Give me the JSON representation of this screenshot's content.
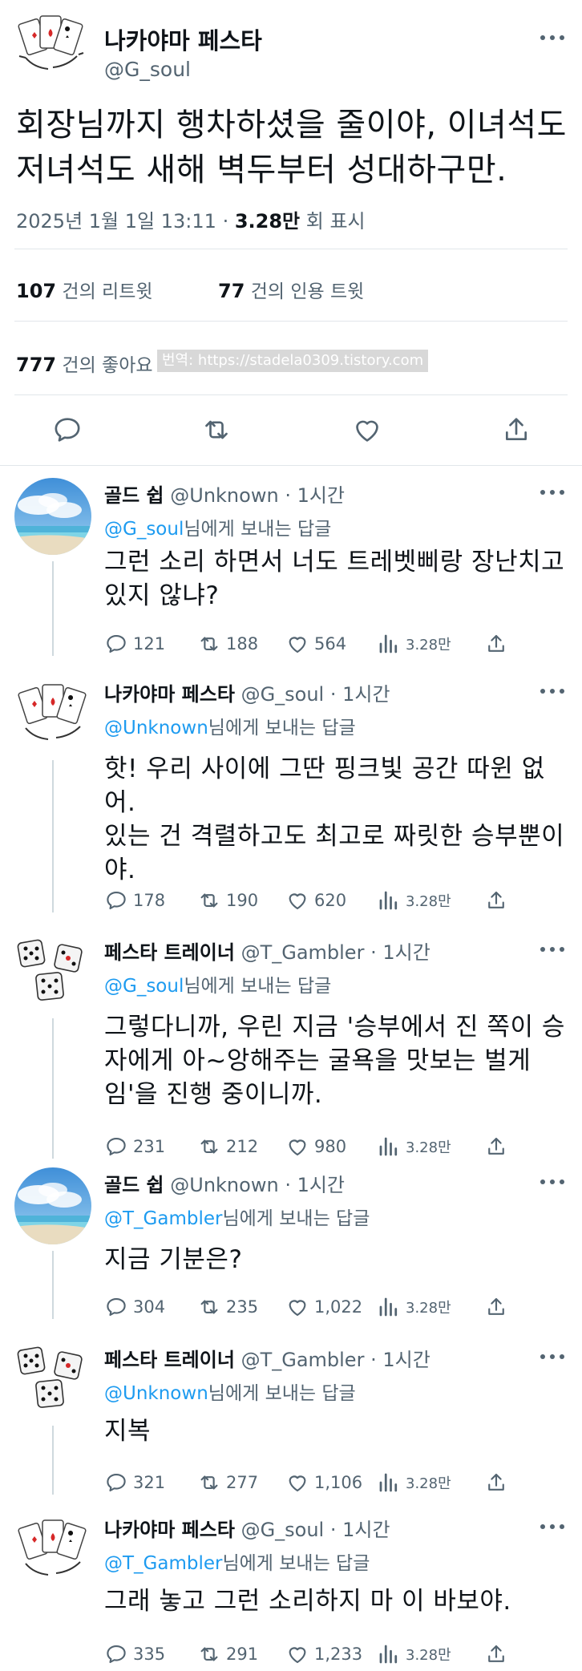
{
  "main": {
    "name": "나카야마 페스타",
    "handle": "@G_soul",
    "text": "회장님까지 행차하셨을 줄이야, 이녀석도 저녀석도 새해 벽두부터 성대하구만.",
    "date": "2025년 1월 1일  13:11",
    "views": "3.28만",
    "views_label": "회 표시",
    "retweets": "107",
    "retweets_label": "건의 리트윗",
    "quotes": "77",
    "quotes_label": "건의 인용 트윗",
    "likes": "777",
    "likes_label": "건의 좋아요",
    "watermark": "번역: https://stadela0309.tistory.com"
  },
  "replies": [
    {
      "name": "골드 쉽",
      "handle": "@Unknown",
      "time": "· 1시간",
      "reply_to": "@G_soul",
      "reply_suffix": "님에게 보내는 답글",
      "text": "그런 소리 하면서 너도 트레벳삐랑 장난치고 있지 않냐?",
      "replies": "121",
      "retweets": "188",
      "likes": "564",
      "views": "3.28만",
      "avatar": "beach"
    },
    {
      "name": "나카야마 페스타",
      "handle": "@G_soul",
      "time": "· 1시간",
      "reply_to": "@Unknown",
      "reply_suffix": "님에게 보내는 답글",
      "text": "핫! 우리 사이에 그딴 핑크빛 공간 따윈 없어.\n있는 건 격렬하고도 최고로 짜릿한 승부뿐이야.",
      "replies": "178",
      "retweets": "190",
      "likes": "620",
      "views": "3.28만",
      "avatar": "cards"
    },
    {
      "name": "페스타 트레이너",
      "handle": "@T_Gambler",
      "time": "· 1시간",
      "reply_to": "@G_soul",
      "reply_suffix": "님에게 보내는 답글",
      "text": "그렇다니까, 우린 지금 '승부에서 진 쪽이 승자에게 아~앙해주는 굴욕을 맛보는 벌게임'을 진행 중이니까.",
      "replies": "231",
      "retweets": "212",
      "likes": "980",
      "views": "3.28만",
      "avatar": "dice"
    },
    {
      "name": "골드 쉽",
      "handle": "@Unknown",
      "time": "· 1시간",
      "reply_to": "@T_Gambler",
      "reply_suffix": "님에게 보내는 답글",
      "text": "지금 기분은?",
      "replies": "304",
      "retweets": "235",
      "likes": "1,022",
      "views": "3.28만",
      "avatar": "beach"
    },
    {
      "name": "페스타 트레이너",
      "handle": "@T_Gambler",
      "time": "· 1시간",
      "reply_to": "@Unknown",
      "reply_suffix": "님에게 보내는 답글",
      "text": "지복",
      "replies": "321",
      "retweets": "277",
      "likes": "1,106",
      "views": "3.28만",
      "avatar": "dice"
    },
    {
      "name": "나카야마 페스타",
      "handle": "@G_soul",
      "time": "· 1시간",
      "reply_to": "@T_Gambler",
      "reply_suffix": "님에게 보내는 답글",
      "text": "그래 놓고 그런 소리하지 마 이 바보야.",
      "replies": "335",
      "retweets": "291",
      "likes": "1,233",
      "views": "3.28만",
      "avatar": "cards"
    }
  ],
  "icons": {
    "reply": "reply-icon",
    "retweet": "retweet-icon",
    "like": "heart-icon",
    "views": "views-icon",
    "share": "share-icon",
    "more": "more-icon"
  },
  "colors": {
    "text": "#0f1419",
    "muted": "#536471",
    "link": "#1d9bf0",
    "divider": "#e1e6ea"
  }
}
